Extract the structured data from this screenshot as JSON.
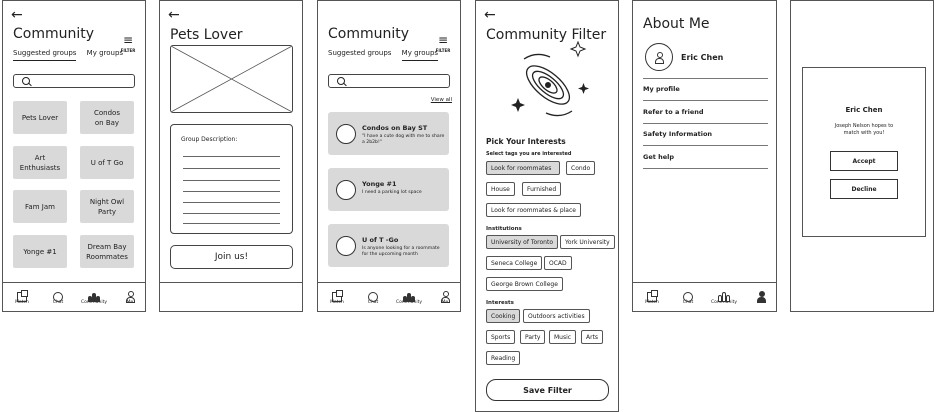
{
  "screen1": {
    "title": "Community",
    "filter_label": "FILTER",
    "tabs": [
      "Suggested groups",
      "My groups"
    ],
    "groups": [
      "Pets Lover",
      "Condos\non Bay",
      "Art\nEnthusiasts",
      "U of T Go",
      "Fam Jam",
      "Night Owl\nParty",
      "Yonge #1",
      "Dream Bay\nRoommates"
    ]
  },
  "screen2": {
    "title": "Pets Lover",
    "description_label": "Group Description:",
    "join_label": "Join us!"
  },
  "screen3": {
    "title": "Community",
    "filter_label": "FILTER",
    "tabs": [
      "Suggested groups",
      "My groups"
    ],
    "view_all": "View all",
    "groups": [
      {
        "name": "Condos on Bay ST",
        "desc": "\"I have a cute dog with me to share a 2b2b!\""
      },
      {
        "name": "Yonge #1",
        "desc": "I need a parking lot space"
      },
      {
        "name": "U of T -Go",
        "desc": "Is anyone looking for a roommate for the upcoming month"
      }
    ]
  },
  "screen4": {
    "title": "Community Filter",
    "pick_heading": "Pick Your Interests",
    "select_label": "Select tags you are interested",
    "tags": [
      "Look for roommates",
      "Condo",
      "House",
      "Furnished",
      "Look for roommates & place"
    ],
    "institutions_label": "Institutions",
    "institutions": [
      "University of Toronto",
      "York University",
      "Seneca College",
      "OCAD",
      "George Brown College"
    ],
    "interests_label": "Interests",
    "interests": [
      "Cooking",
      "Outdoors activities",
      "Sports",
      "Party",
      "Music",
      "Arts",
      "Reading"
    ],
    "save_label": "Save Filter"
  },
  "screen5": {
    "title": "About Me",
    "user_name": "Eric Chen",
    "menu": [
      "My profile",
      "Refer to a friend",
      "Safety Information",
      "Get help"
    ]
  },
  "screen6": {
    "name": "Eric Chen",
    "message": "Joseph Nelson hopes to match with you!",
    "accept_label": "Accept",
    "decline_label": "Decline"
  },
  "tabbar": {
    "items": [
      "Match",
      "Chat",
      "Community",
      "Me"
    ]
  }
}
